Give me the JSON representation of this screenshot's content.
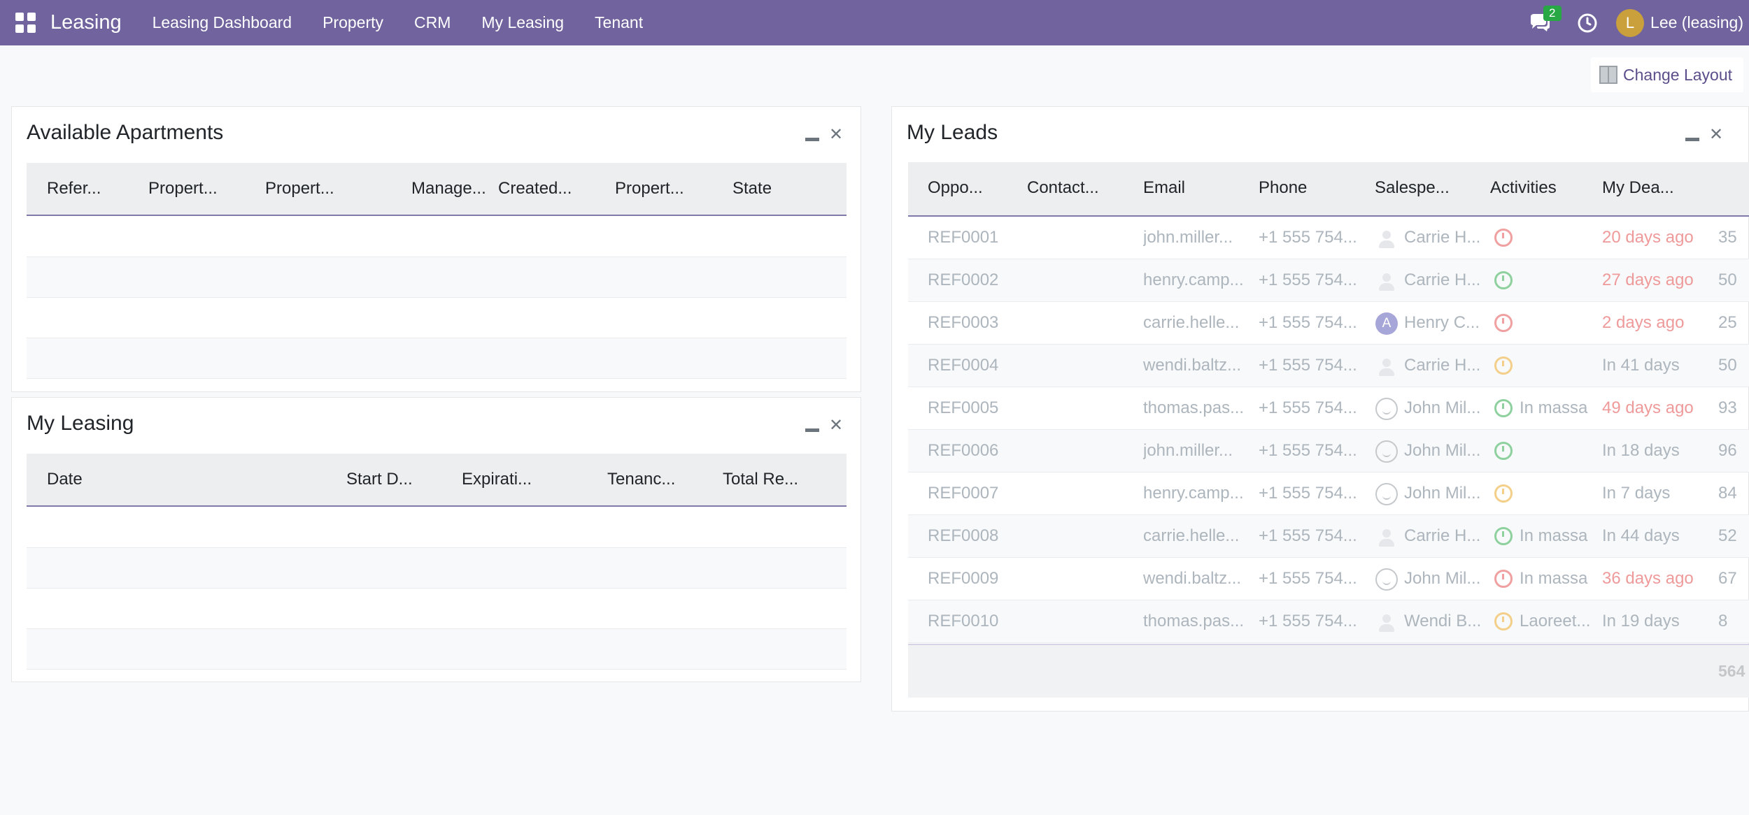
{
  "navbar": {
    "app_name": "Leasing",
    "menu": [
      "Leasing Dashboard",
      "Property",
      "CRM",
      "My Leasing",
      "Tenant"
    ],
    "chat_badge": "2",
    "user_initial": "L",
    "user_name": "Lee (leasing)",
    "bg_color": "#71639e"
  },
  "toolbar": {
    "change_layout_label": "Change Layout"
  },
  "available_apartments": {
    "title": "Available Apartments",
    "columns": [
      "Refer...",
      "Propert...",
      "Propert...",
      "Manage...",
      "Created...",
      "Propert...",
      "State"
    ]
  },
  "my_leasing": {
    "title": "My Leasing",
    "columns": [
      "Date",
      "Start D...",
      "Expirati...",
      "Tenanc...",
      "Total Re..."
    ]
  },
  "my_leads": {
    "title": "My Leads",
    "columns": [
      "Oppo...",
      "Contact...",
      "Email",
      "Phone",
      "Salespe...",
      "Activities",
      "My Dea..."
    ],
    "rows": [
      {
        "ref": "REF0001",
        "email": "john.miller...",
        "phone": "+1 555 754...",
        "salesperson": "Carrie H...",
        "avatar": "ghost",
        "activity": "red",
        "activity_text": "",
        "deadline": "20 days ago",
        "overdue": true,
        "value": "35"
      },
      {
        "ref": "REF0002",
        "email": "henry.camp...",
        "phone": "+1 555 754...",
        "salesperson": "Carrie H...",
        "avatar": "ghost",
        "activity": "green",
        "activity_text": "",
        "deadline": "27 days ago",
        "overdue": true,
        "value": "50"
      },
      {
        "ref": "REF0003",
        "email": "carrie.helle...",
        "phone": "+1 555 754...",
        "salesperson": "Henry C...",
        "avatar": "A",
        "activity": "red",
        "activity_text": "",
        "deadline": "2 days ago",
        "overdue": true,
        "value": "25"
      },
      {
        "ref": "REF0004",
        "email": "wendi.baltz...",
        "phone": "+1 555 754...",
        "salesperson": "Carrie H...",
        "avatar": "ghost",
        "activity": "orange",
        "activity_text": "",
        "deadline": "In 41 days",
        "overdue": false,
        "value": "50"
      },
      {
        "ref": "REF0005",
        "email": "thomas.pas...",
        "phone": "+1 555 754...",
        "salesperson": "John Mil...",
        "avatar": "smile",
        "activity": "green",
        "activity_text": "In massa",
        "deadline": "49 days ago",
        "overdue": true,
        "value": "93"
      },
      {
        "ref": "REF0006",
        "email": "john.miller...",
        "phone": "+1 555 754...",
        "salesperson": "John Mil...",
        "avatar": "smile",
        "activity": "green",
        "activity_text": "",
        "deadline": "In 18 days",
        "overdue": false,
        "value": "96"
      },
      {
        "ref": "REF0007",
        "email": "henry.camp...",
        "phone": "+1 555 754...",
        "salesperson": "John Mil...",
        "avatar": "smile",
        "activity": "orange",
        "activity_text": "",
        "deadline": "In 7 days",
        "overdue": false,
        "value": "84"
      },
      {
        "ref": "REF0008",
        "email": "carrie.helle...",
        "phone": "+1 555 754...",
        "salesperson": "Carrie H...",
        "avatar": "ghost",
        "activity": "green",
        "activity_text": "In massa",
        "deadline": "In 44 days",
        "overdue": false,
        "value": "52"
      },
      {
        "ref": "REF0009",
        "email": "wendi.baltz...",
        "phone": "+1 555 754...",
        "salesperson": "John Mil...",
        "avatar": "smile",
        "activity": "red",
        "activity_text": "In massa",
        "deadline": "36 days ago",
        "overdue": true,
        "value": "67"
      },
      {
        "ref": "REF0010",
        "email": "thomas.pas...",
        "phone": "+1 555 754...",
        "salesperson": "Wendi B...",
        "avatar": "ghost",
        "activity": "orange",
        "activity_text": "Laoreet...",
        "deadline": "In 19 days",
        "overdue": false,
        "value": "8"
      }
    ],
    "total": "564"
  }
}
